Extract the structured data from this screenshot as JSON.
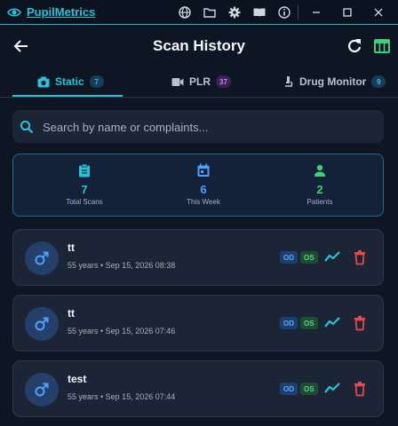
{
  "app": {
    "name": "PupilMetrics"
  },
  "header": {
    "title": "Scan History"
  },
  "tabs": [
    {
      "label": "Static",
      "count": "7"
    },
    {
      "label": "PLR",
      "count": "37"
    },
    {
      "label": "Drug Monitor",
      "count": "9"
    }
  ],
  "search": {
    "placeholder": "Search by name or complaints...",
    "value": ""
  },
  "stats": [
    {
      "value": "7",
      "label": "Total Scans"
    },
    {
      "value": "6",
      "label": "This Week"
    },
    {
      "value": "2",
      "label": "Patients"
    }
  ],
  "scans": [
    {
      "name": "tt",
      "meta": "55 years • Sep 15, 2026 08:38",
      "od": "OD",
      "os": "OS"
    },
    {
      "name": "tt",
      "meta": "55 years • Sep 15, 2026 07:46",
      "od": "OD",
      "os": "OS"
    },
    {
      "name": "test",
      "meta": "55 years • Sep 15, 2026 07:44",
      "od": "OD",
      "os": "OS"
    }
  ],
  "colors": {
    "accent": "#27c3d4",
    "success": "#3fce7a",
    "danger": "#e5484d",
    "blue": "#4aa3ff"
  }
}
